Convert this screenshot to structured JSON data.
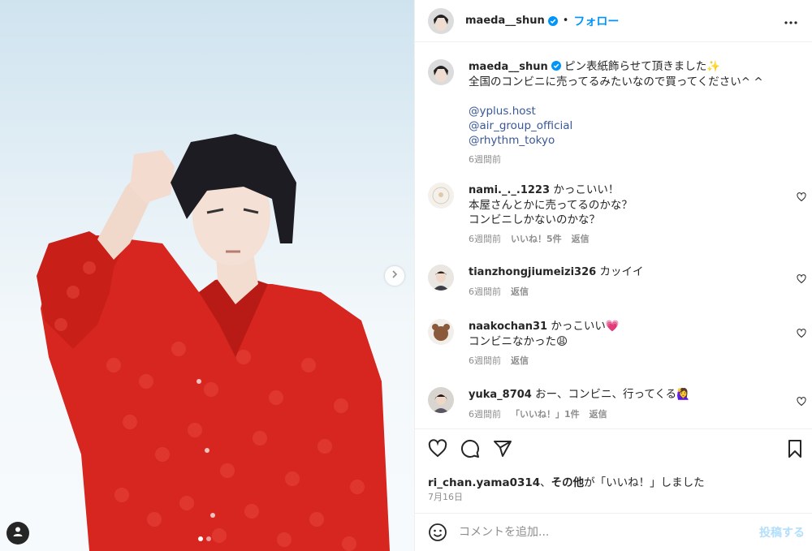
{
  "post": {
    "author": "maeda__shun",
    "follow_label": "フォロー",
    "separator": "•"
  },
  "caption": {
    "username": "maeda__shun",
    "line1": "ピン表紙飾らせて頂きました✨",
    "line2": "全国のコンビニに売ってるみたいなので買ってください^ ^",
    "mentions": [
      "@yplus.host",
      "@air_group_official",
      "@rhythm_tokyo"
    ],
    "time": "6週間前"
  },
  "comments": [
    {
      "username": "nami._._.1223",
      "lines": [
        "かっこいい！",
        "本屋さんとかに売ってるのかな？",
        "コンビニしかないのかな？"
      ],
      "time": "6週間前",
      "likes": "いいね！5件",
      "reply": "返信"
    },
    {
      "username": "tianzhongjiumeizi326",
      "lines": [
        "カッイイ"
      ],
      "time": "6週間前",
      "likes": "",
      "reply": "返信"
    },
    {
      "username": "naakochan31",
      "lines": [
        "かっこいい💗",
        "コンビニなかった😩"
      ],
      "time": "6週間前",
      "likes": "",
      "reply": "返信"
    },
    {
      "username": "yuka_8704",
      "lines": [
        "おー、コンビニ、行ってくる🙋‍♀️"
      ],
      "time": "6週間前",
      "likes": "「いいね！」1件",
      "reply": "返信"
    }
  ],
  "likes_line": {
    "user": "ri_chan.yama0314",
    "comma": "、",
    "others": "その他",
    "suffix": "が「いいね！」しました"
  },
  "date": "7月16日",
  "comment_box": {
    "placeholder": "コメントを追加...",
    "post_label": "投稿する"
  },
  "carousel": {
    "index": 1,
    "count": 2
  },
  "colors": {
    "accent": "#0095f6",
    "verified": "#0095f6",
    "shirt": "#d6261f",
    "muted": "#8e8e8e"
  },
  "icons": [
    "more-icon",
    "heart-icon",
    "comment-icon",
    "share-icon",
    "bookmark-icon",
    "emoji-icon",
    "chevron-right-icon",
    "user-tag-icon",
    "verified-icon"
  ]
}
